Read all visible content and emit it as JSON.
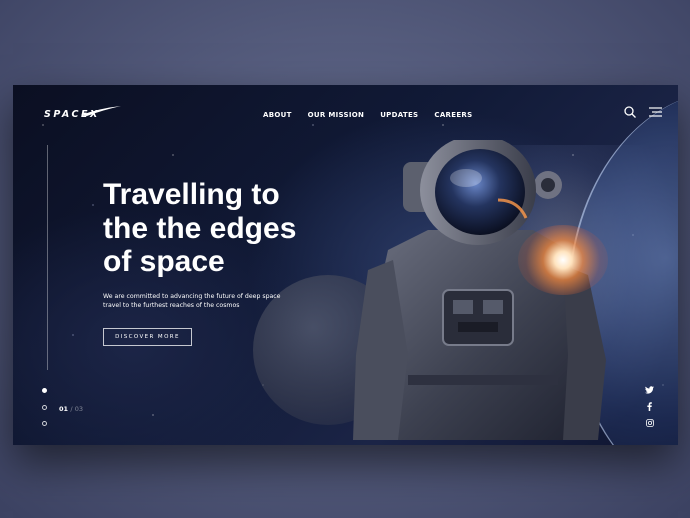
{
  "brand": {
    "logo_text": "SPACEX"
  },
  "nav": {
    "items": [
      {
        "label": "ABOUT"
      },
      {
        "label": "OUR MISSION"
      },
      {
        "label": "UPDATES"
      },
      {
        "label": "CAREERS"
      }
    ]
  },
  "header_icons": [
    "search-icon",
    "menu-icon"
  ],
  "hero": {
    "headline_lines": [
      "Travelling to",
      "the the edges",
      "of space"
    ],
    "subtitle_lines": [
      "We are committed to advancing the future of deep space",
      "travel to the furthest reaches of the cosmos"
    ],
    "cta_label": "DISCOVER MORE"
  },
  "pager": {
    "current": "01",
    "separator": "/",
    "total": "03"
  },
  "social_icons": [
    "twitter-icon",
    "facebook-icon",
    "instagram-icon"
  ],
  "colors": {
    "page_background": "#585f80",
    "hero_background": "#111a37",
    "text": "#ffffff",
    "flare_accent": "#ff8c3c"
  }
}
